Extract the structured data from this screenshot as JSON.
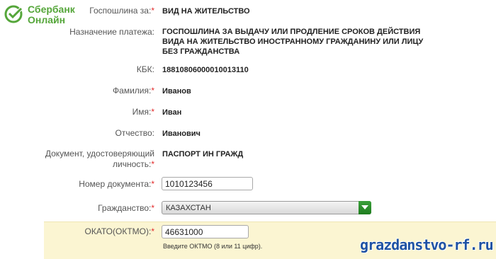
{
  "brand": {
    "line1": "Сбербанк",
    "line2": "Онлайн",
    "color": "#55a63a"
  },
  "form": {
    "fee_label": "Госпошлина за:",
    "fee_value": "ВИД НА ЖИТЕЛЬСТВО",
    "purpose_label": "Назначение платежа:",
    "purpose_value": "ГОСПОШЛИНА ЗА ВЫДАЧУ ИЛИ ПРОДЛЕНИЕ СРОКОВ ДЕЙСТВИЯ ВИДА НА ЖИТЕЛЬСТВО ИНОСТРАННОМУ ГРАЖДАНИНУ ИЛИ ЛИЦУ БЕЗ ГРАЖДАНСТВА",
    "kbk_label": "КБК:",
    "kbk_value": "18810806000010013110",
    "lastname_label": "Фамилия:",
    "lastname_value": "Иванов",
    "firstname_label": "Имя:",
    "firstname_value": "Иван",
    "patronymic_label": "Отчество:",
    "patronymic_value": "Иванович",
    "document_label_line1": "Документ, удостоверяющий",
    "document_label_line2": "личность:",
    "document_value": "ПАСПОРТ ИН ГРАЖД",
    "docnum_label": "Номер документа:",
    "docnum_value": "1010123456",
    "citizenship_label": "Гражданство:",
    "citizenship_value": "КАЗАХСТАН",
    "okato_label": "ОКАТО(ОКТМО):",
    "okato_value": "46631000",
    "okato_hint": "Введите ОКТМО (8 или 11 цифр)."
  },
  "required_marker": "*",
  "watermark": "grazdanstvo-rf.ru",
  "colors": {
    "accent_green": "#55a63a",
    "required_red": "#e32b2b",
    "highlight_bg": "#fbf5d2",
    "watermark_blue": "#1f52a3"
  }
}
